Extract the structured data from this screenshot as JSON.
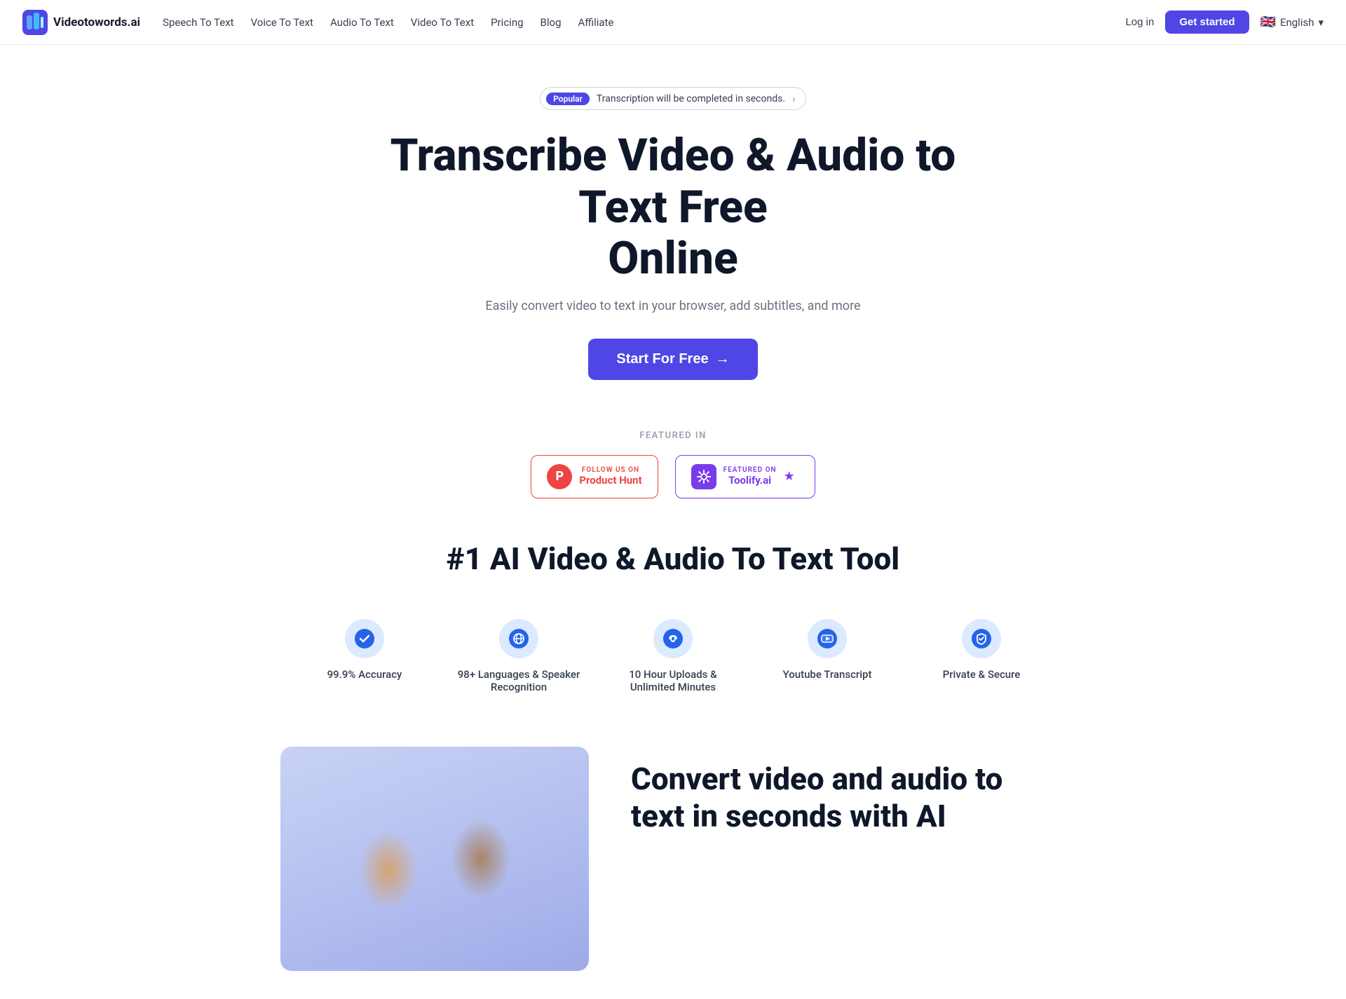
{
  "navbar": {
    "logo_text": "Videotowords.ai",
    "nav_links": [
      {
        "label": "Speech To Text",
        "href": "#"
      },
      {
        "label": "Voice To Text",
        "href": "#"
      },
      {
        "label": "Audio To Text",
        "href": "#"
      },
      {
        "label": "Video To Text",
        "href": "#"
      },
      {
        "label": "Pricing",
        "href": "#"
      },
      {
        "label": "Blog",
        "href": "#"
      },
      {
        "label": "Affiliate",
        "href": "#"
      }
    ],
    "login_label": "Log in",
    "get_started_label": "Get started",
    "language_label": "English",
    "language_code": "EN",
    "flag_emoji": "🇬🇧"
  },
  "hero": {
    "badge_popular": "Popular",
    "badge_text": "Transcription will be completed in seconds.",
    "heading_line1": "Transcribe Video & Audio to Text Free",
    "heading_line2": "Online",
    "subtitle": "Easily convert video to text in your browser, add subtitles, and more",
    "cta_label": "Start For Free",
    "cta_arrow": "→"
  },
  "featured": {
    "label": "FEATURED IN",
    "producthunt": {
      "follow_label": "FOLLOW US ON",
      "name": "Product Hunt",
      "icon_letter": "P"
    },
    "toolify": {
      "featured_label": "FEATURED ON",
      "name": "Toolify.ai",
      "star": "★"
    }
  },
  "ai_tool": {
    "heading": "#1 AI Video & Audio To Text Tool",
    "features": [
      {
        "icon": "✓",
        "icon_name": "check-icon",
        "label": "99.9% Accuracy",
        "color_class": "icon-check"
      },
      {
        "icon": "🌐",
        "icon_name": "globe-icon",
        "label": "98+ Languages & Speaker Recognition",
        "color_class": "icon-globe"
      },
      {
        "icon": "∞",
        "icon_name": "infinity-icon",
        "label": "10 Hour Uploads & Unlimited Minutes",
        "color_class": "icon-infinity"
      },
      {
        "icon": "▶",
        "icon_name": "youtube-icon",
        "label": "Youtube Transcript",
        "color_class": "icon-youtube"
      },
      {
        "icon": "🛡",
        "icon_name": "shield-icon",
        "label": "Private & Secure",
        "color_class": "icon-shield"
      }
    ]
  },
  "bottom": {
    "heading_line1": "Convert video and audio to",
    "heading_line2": "text in seconds with AI"
  }
}
